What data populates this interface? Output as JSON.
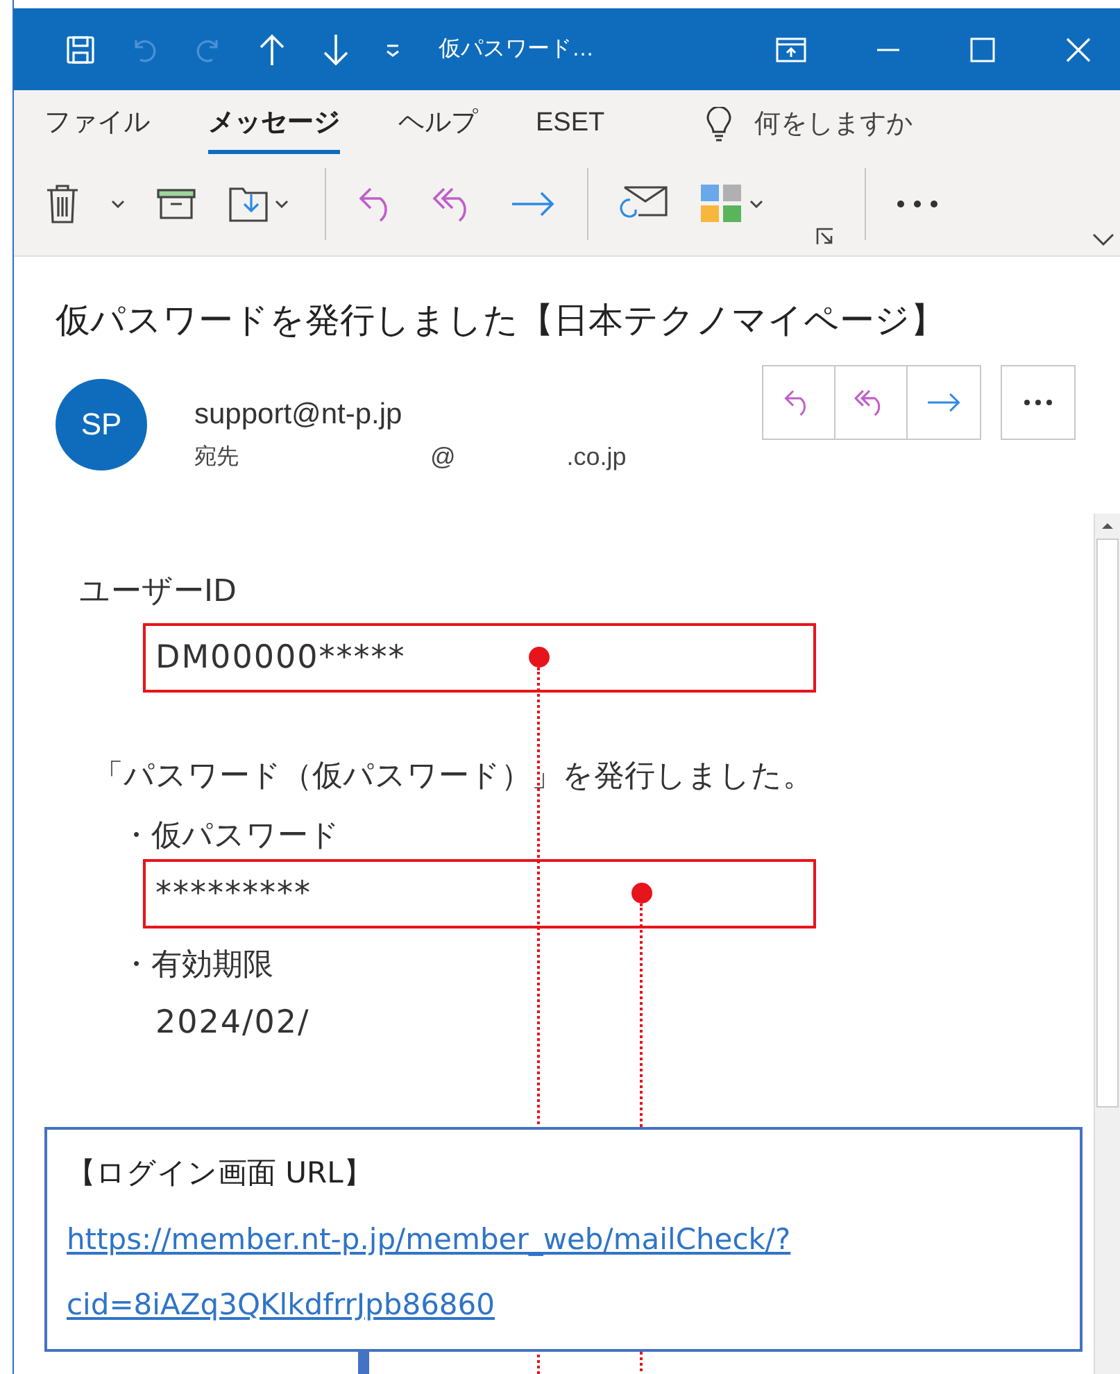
{
  "title_bar": {
    "title": "仮パスワード…"
  },
  "ribbon_tabs": [
    {
      "label": "ファイル",
      "selected": false
    },
    {
      "label": "メッセージ",
      "selected": true
    },
    {
      "label": "ヘルプ",
      "selected": false
    },
    {
      "label": "ESET",
      "selected": false
    }
  ],
  "tell_me": {
    "placeholder": "何をしますか"
  },
  "message": {
    "subject": "仮パスワードを発行しました【日本テクノマイページ】",
    "avatar": "SP",
    "sender": "support@nt-p.jp",
    "to_label": "宛先",
    "to_parts": [
      "@",
      ".co.jp"
    ]
  },
  "body": [
    {
      "kind": "label",
      "text": "ユーザーID"
    },
    {
      "kind": "value",
      "text": "DM00000*****",
      "highlighted": true
    },
    {
      "kind": "sentence",
      "text": "「パスワード（仮パスワード）」を発行しました。"
    },
    {
      "kind": "bullet",
      "text": "・仮パスワード"
    },
    {
      "kind": "value",
      "text": "*********",
      "highlighted": true
    },
    {
      "kind": "bullet",
      "text": "・有効期限"
    },
    {
      "kind": "value",
      "text": "2024/02/",
      "highlighted": false
    }
  ],
  "callout": {
    "heading": "【ログイン画面 URL】",
    "url_lines": [
      "https://member.nt-p.jp/member_web/mailCheck/?",
      "cid=8iAZq3QKlkdfrrJpb86860"
    ]
  }
}
